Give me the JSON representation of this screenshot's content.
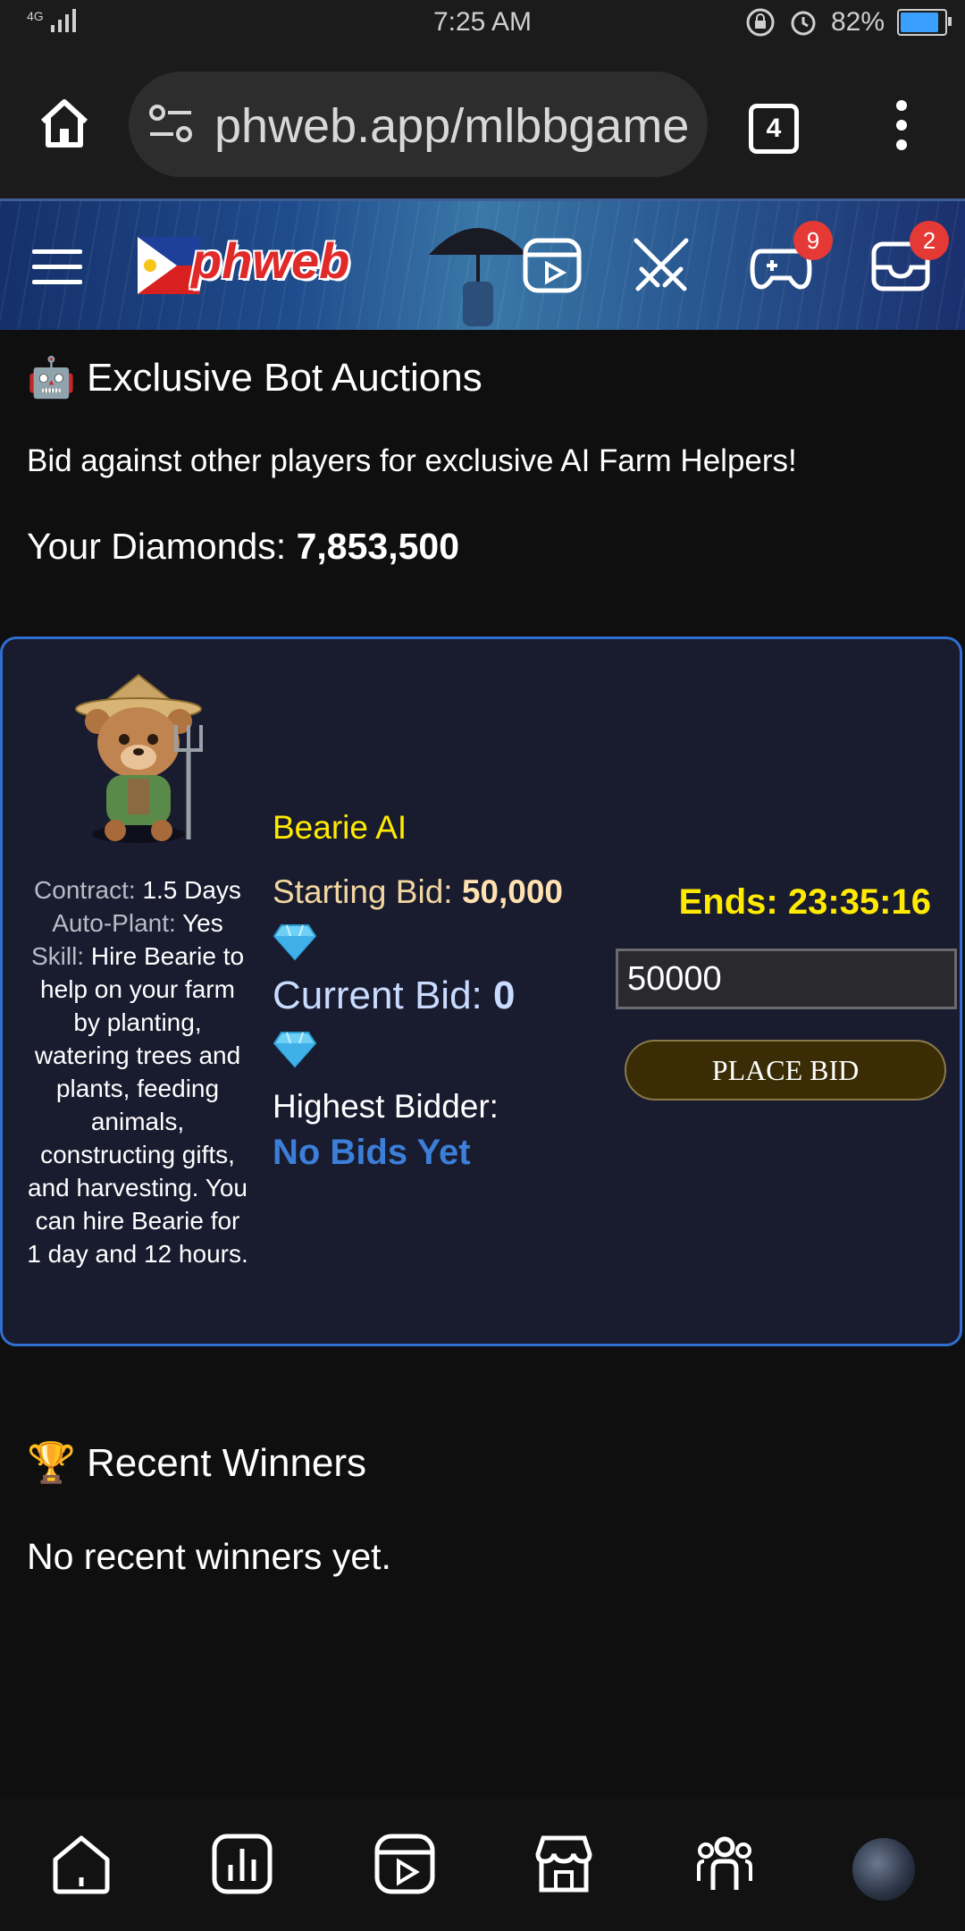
{
  "status_bar": {
    "network": "4G",
    "time": "7:25 AM",
    "battery_percent": "82%"
  },
  "browser": {
    "url": "phweb.app/mlbbgame",
    "tab_count": "4"
  },
  "site_header": {
    "logo_text": "phweb",
    "games_badge": "9",
    "inbox_badge": "2"
  },
  "auctions": {
    "icon": "🤖",
    "title": "Exclusive Bot Auctions",
    "subtitle": "Bid against other players for exclusive AI Farm Helpers!",
    "diamonds_label": "Your Diamonds:",
    "diamonds_value": "7,853,500"
  },
  "bot": {
    "name": "Bearie AI",
    "contract_label": "Contract:",
    "contract_value": "1.5 Days",
    "autoplant_label": "Auto-Plant:",
    "autoplant_value": "Yes",
    "skill_label": "Skill:",
    "skill_text": "Hire Bearie to help on your farm by planting, watering trees and plants, feeding animals, constructing gifts, and harvesting. You can hire Bearie for 1 day and 12 hours.",
    "starting_bid_label": "Starting Bid:",
    "starting_bid_value": "50,000",
    "current_bid_label": "Current Bid:",
    "current_bid_value": "0",
    "highest_bidder_label": "Highest Bidder:",
    "highest_bidder_value": "No Bids Yet",
    "ends_label": "Ends:",
    "ends_value": "23:35:16",
    "bid_input_value": "50000",
    "place_bid_label": "PLACE BID"
  },
  "winners": {
    "icon": "🏆",
    "title": "Recent Winners",
    "empty_text": "No recent winners yet."
  },
  "bottom_nav": [
    "home-icon",
    "chart-icon",
    "video-icon",
    "store-icon",
    "group-icon",
    "avatar"
  ]
}
